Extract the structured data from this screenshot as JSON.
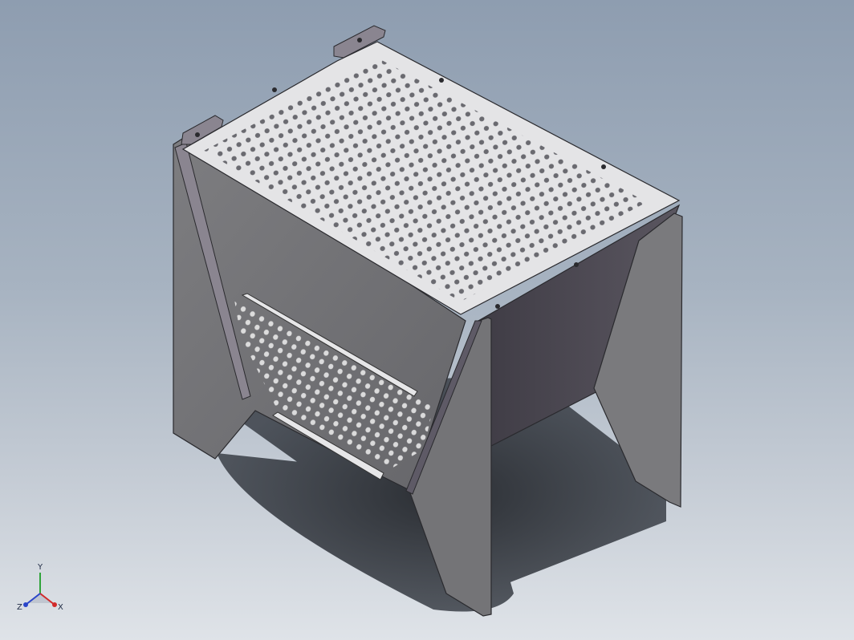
{
  "viewport": {
    "background_top": "#8e9db0",
    "background_bottom": "#dfe3e8"
  },
  "model": {
    "description_icon": "perforated-fire-pit-model",
    "plate_color": "#e4e4e6",
    "side_color": "#6f6f72",
    "inner_color": "#4a474f",
    "shadow_color": "#2e3135"
  },
  "triad": {
    "x_label": "X",
    "y_label": "Y",
    "z_label": "Z",
    "x_color": "#d22a2a",
    "y_color": "#2fa33a",
    "z_color": "#2a45c9"
  }
}
